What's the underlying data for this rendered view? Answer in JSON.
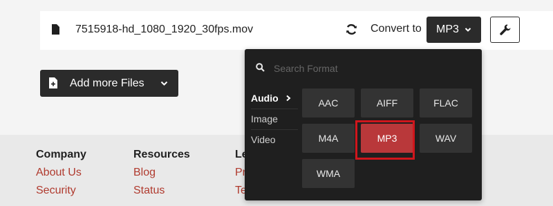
{
  "file": {
    "name": "7515918-hd_1080_1920_30fps.mov"
  },
  "convert": {
    "label": "Convert to",
    "selected_format": "MP3"
  },
  "add_files": {
    "label": "Add more Files"
  },
  "dropdown": {
    "search_placeholder": "Search Format",
    "categories": [
      "Audio",
      "Image",
      "Video"
    ],
    "active_category": "Audio",
    "formats": [
      "AAC",
      "AIFF",
      "FLAC",
      "M4A",
      "MP3",
      "WAV",
      "WMA"
    ],
    "selected": "MP3"
  },
  "footer": {
    "columns": [
      {
        "title": "Company",
        "links": [
          "About Us",
          "Security"
        ]
      },
      {
        "title": "Resources",
        "links": [
          "Blog",
          "Status"
        ]
      },
      {
        "title": "Le",
        "links": [
          "Pr",
          "Te"
        ]
      }
    ]
  },
  "colors": {
    "accent": "#b9383a",
    "highlight": "#d0161c",
    "link": "#b03a2e",
    "dark": "#2b2b2b"
  },
  "icons": {
    "file": "file-icon",
    "refresh": "refresh-icon",
    "settings": "wrench-icon",
    "search": "search-icon",
    "add": "file-plus-icon"
  }
}
